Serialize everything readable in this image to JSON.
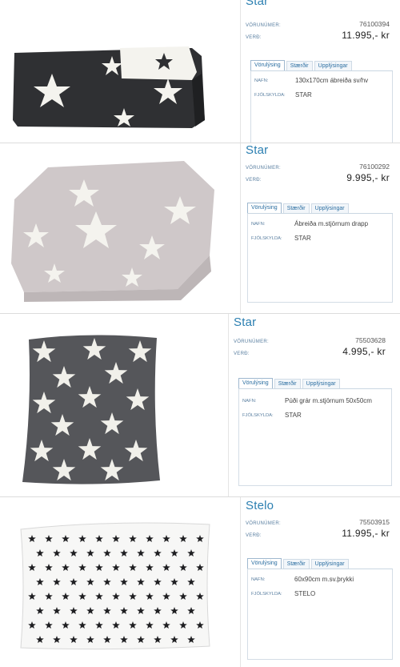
{
  "labels": {
    "sku_label": "VÖRUNÚMER:",
    "price_label": "VERÐ:",
    "name_label": "NAFN:",
    "family_label": "FJÖLSKYLDA:"
  },
  "tabs": [
    "Vörulýsing",
    "Stærðir",
    "Upplýsingar"
  ],
  "products": [
    {
      "title": "Star",
      "sku": "76100394",
      "price": "11.995,- kr",
      "name": "130x170cm ábreiða sv/hv",
      "family": "STAR",
      "image": "dark-star-blanket"
    },
    {
      "title": "Star",
      "sku": "76100292",
      "price": "9.995,- kr",
      "name": "Ábreiða m.stjörnum drapp",
      "family": "STAR",
      "image": "beige-star-blanket"
    },
    {
      "title": "Star",
      "sku": "75503628",
      "price": "4.995,- kr",
      "name": "Púði grár m.stjörnum 50x50cm",
      "family": "STAR",
      "image": "grey-star-cushion"
    },
    {
      "title": "Stelo",
      "sku": "75503915",
      "price": "11.995,- kr",
      "name": "60x90cm m.sv.þrykki",
      "family": "STELO",
      "image": "white-star-pillow"
    }
  ],
  "colors": {
    "title": "#2b7fb1",
    "dark_knit": "#2f3033",
    "beige_knit": "#cfc8c9",
    "grey_knit": "#55565a",
    "star_white": "#f4f3ee",
    "star_black": "#1f1f22"
  }
}
